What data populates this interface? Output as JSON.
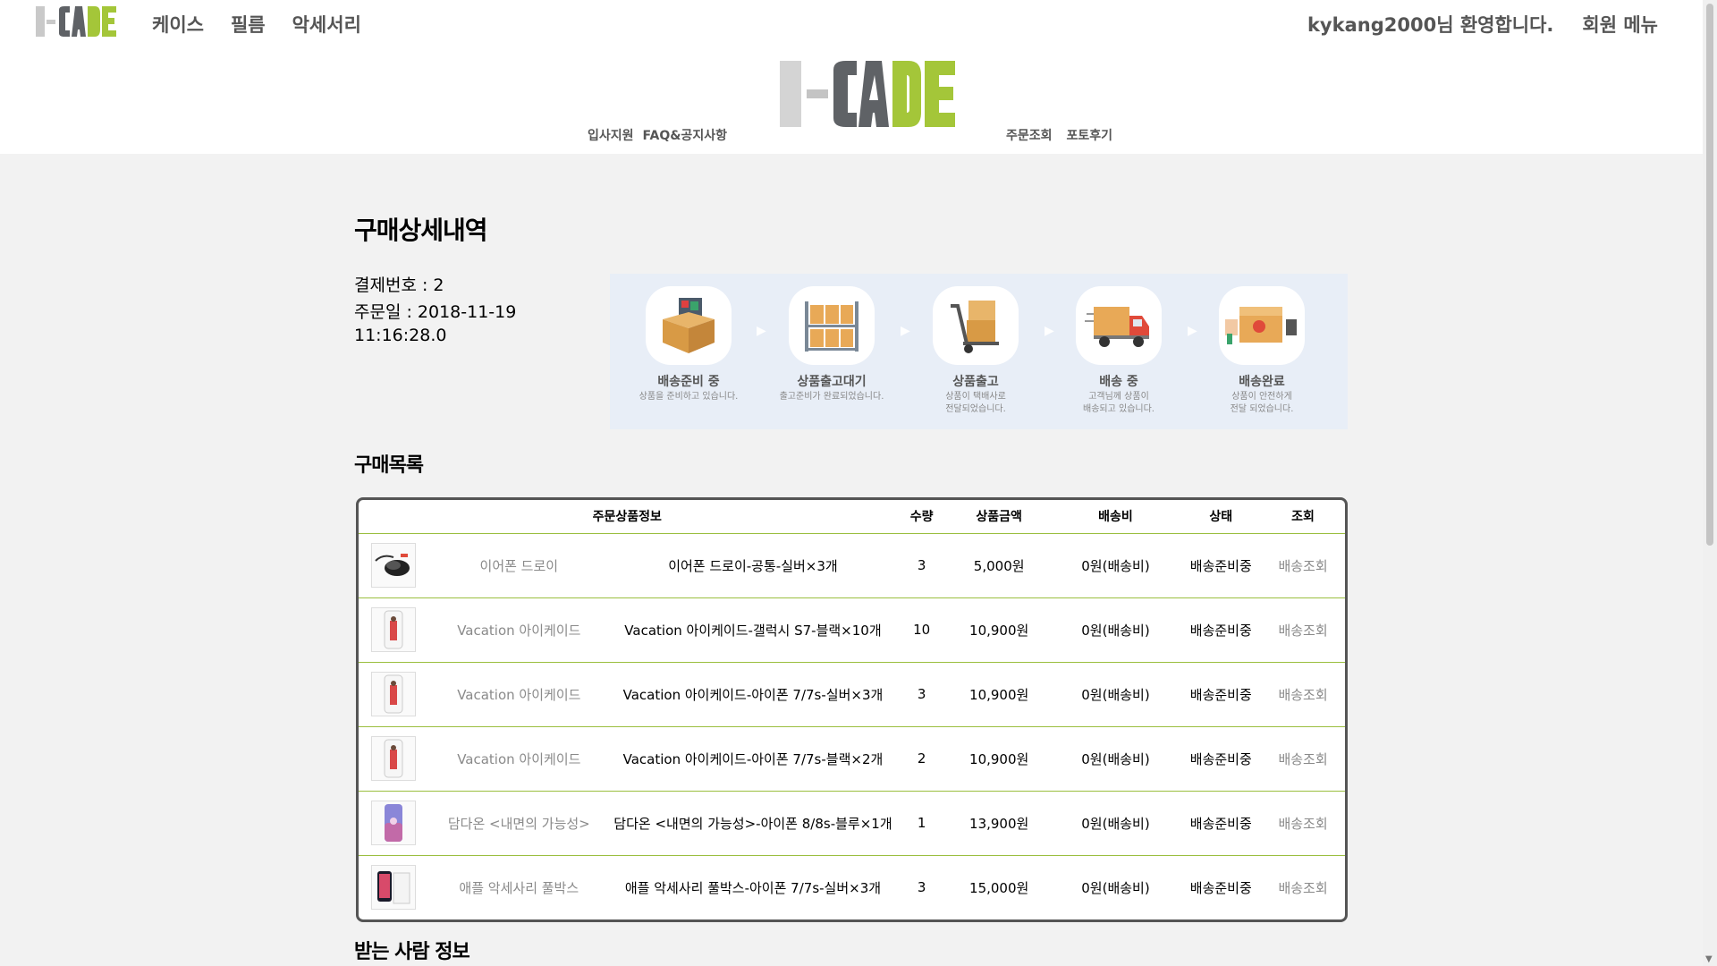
{
  "brand": {
    "logo_text": "I-CADE",
    "colors": {
      "gray": "#c9c9c9",
      "dark": "#5f6266",
      "green": "#a4c639"
    }
  },
  "topnav": {
    "items": [
      {
        "label": "케이스"
      },
      {
        "label": "필름"
      },
      {
        "label": "악세서리"
      }
    ],
    "welcome": "kykang2000님 환영합니다.",
    "member_menu": "회원 메뉴"
  },
  "subnav": {
    "left": [
      {
        "label": "입사지원"
      },
      {
        "label": "FAQ&공지사항"
      }
    ],
    "right": [
      {
        "label": "주문조회"
      },
      {
        "label": "포토후기"
      }
    ]
  },
  "page": {
    "title": "구매상세내역",
    "payment_no": "결제번호 : 2",
    "order_date_line1": "주문일 : 2018-11-19",
    "order_date_line2": "11:16:28.0"
  },
  "progress": {
    "arrow": "▶",
    "steps": [
      {
        "title": "배송준비 중",
        "desc1": "상품을 준비하고 있습니다.",
        "desc2": "",
        "icon": "box-items-icon"
      },
      {
        "title": "상품출고대기",
        "desc1": "출고준비가 완료되었습니다.",
        "desc2": "",
        "icon": "shelf-icon"
      },
      {
        "title": "상품출고",
        "desc1": "상품이 택배사로",
        "desc2": "전달되었습니다.",
        "icon": "hand-truck-icon"
      },
      {
        "title": "배송 중",
        "desc1": "고객님께 상품이",
        "desc2": "배송되고 있습니다.",
        "icon": "truck-icon"
      },
      {
        "title": "배송완료",
        "desc1": "상품이 안전하게",
        "desc2": "전달 되었습니다.",
        "icon": "delivered-box-icon"
      }
    ]
  },
  "order_list": {
    "title": "구매목록",
    "headers": {
      "info": "주문상품정보",
      "qty": "수량",
      "price": "상품금액",
      "ship": "배송비",
      "status": "상태",
      "track": "조회"
    },
    "rows": [
      {
        "name": "이어폰 드로이",
        "option": "이어폰 드로이-공통-실버×3개",
        "qty": "3",
        "price": "5,000원",
        "ship": "0원(배송비)",
        "status": "배송준비중",
        "track": "배송조회",
        "thumb": "earphone"
      },
      {
        "name": "Vacation 아이케이드",
        "option": "Vacation 아이케이드-갤럭시 S7-블랙×10개",
        "qty": "10",
        "price": "10,900원",
        "ship": "0원(배송비)",
        "status": "배송준비중",
        "track": "배송조회",
        "thumb": "case-red"
      },
      {
        "name": "Vacation 아이케이드",
        "option": "Vacation 아이케이드-아이폰 7/7s-실버×3개",
        "qty": "3",
        "price": "10,900원",
        "ship": "0원(배송비)",
        "status": "배송준비중",
        "track": "배송조회",
        "thumb": "case-red"
      },
      {
        "name": "Vacation 아이케이드",
        "option": "Vacation 아이케이드-아이폰 7/7s-블랙×2개",
        "qty": "2",
        "price": "10,900원",
        "ship": "0원(배송비)",
        "status": "배송준비중",
        "track": "배송조회",
        "thumb": "case-red"
      },
      {
        "name": "담다온 <내면의 가능성>",
        "option": "담다온 <내면의 가능성>-아이폰 8/8s-블루×1개",
        "qty": "1",
        "price": "13,900원",
        "ship": "0원(배송비)",
        "status": "배송준비중",
        "track": "배송조회",
        "thumb": "case-blue"
      },
      {
        "name": "애플 악세사리 풀박스",
        "option": "애플 악세사리 풀박스-아이폰 7/7s-실버×3개",
        "qty": "3",
        "price": "15,000원",
        "ship": "0원(배송비)",
        "status": "배송준비중",
        "track": "배송조회",
        "thumb": "phone-box"
      }
    ]
  },
  "receiver": {
    "title": "받는 사람 정보"
  }
}
